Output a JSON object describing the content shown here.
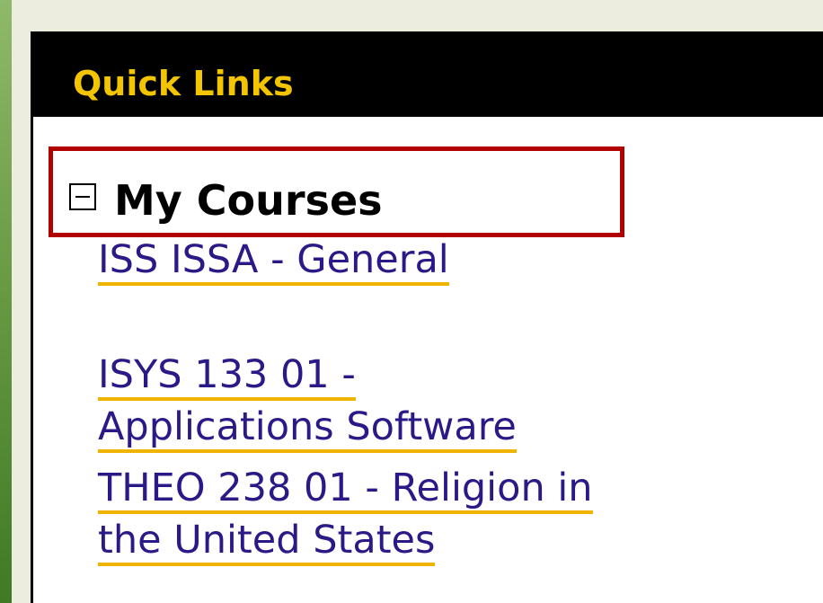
{
  "colors": {
    "header_text": "#f2c500",
    "link": "#2a1a88",
    "link_underline": "#f0b400"
  },
  "quick_links": {
    "title": "Quick Links",
    "my_courses": {
      "toggle_icon": "minus-box-icon",
      "title": "My Courses",
      "links": [
        {
          "lines": [
            "ISS ISSA - General"
          ]
        },
        {
          "lines": [
            "ISYS 133 01 -",
            "Applications Software"
          ]
        },
        {
          "lines": [
            "THEO 238 01 - Religion in",
            "the United States"
          ]
        }
      ]
    }
  }
}
